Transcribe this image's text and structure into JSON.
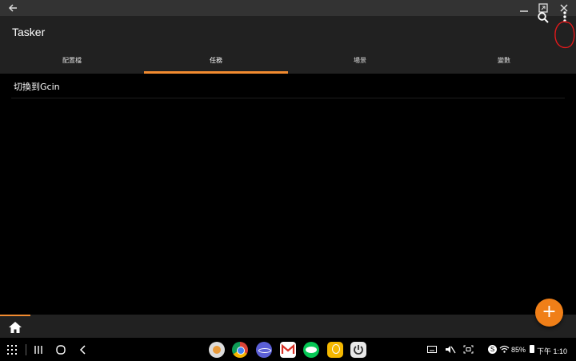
{
  "app": {
    "title": "Tasker"
  },
  "tabs": [
    {
      "label": "配置檔",
      "active": false
    },
    {
      "label": "任務",
      "active": true
    },
    {
      "label": "場景",
      "active": false
    },
    {
      "label": "變數",
      "active": false
    }
  ],
  "tasks": [
    {
      "label": "切換到Gcin"
    }
  ],
  "fab": {
    "label": "+"
  },
  "colors": {
    "accent": "#f28b30",
    "appbar": "#212121",
    "background": "#000000"
  },
  "status": {
    "battery": "85%",
    "time": "下午 1:10",
    "notification_badge": "S"
  },
  "dock_apps": [
    "settings-app-icon",
    "chrome-app-icon",
    "samsung-internet-app-icon",
    "gmail-app-icon",
    "line-app-icon",
    "bulb-app-icon",
    "power-app-icon"
  ]
}
